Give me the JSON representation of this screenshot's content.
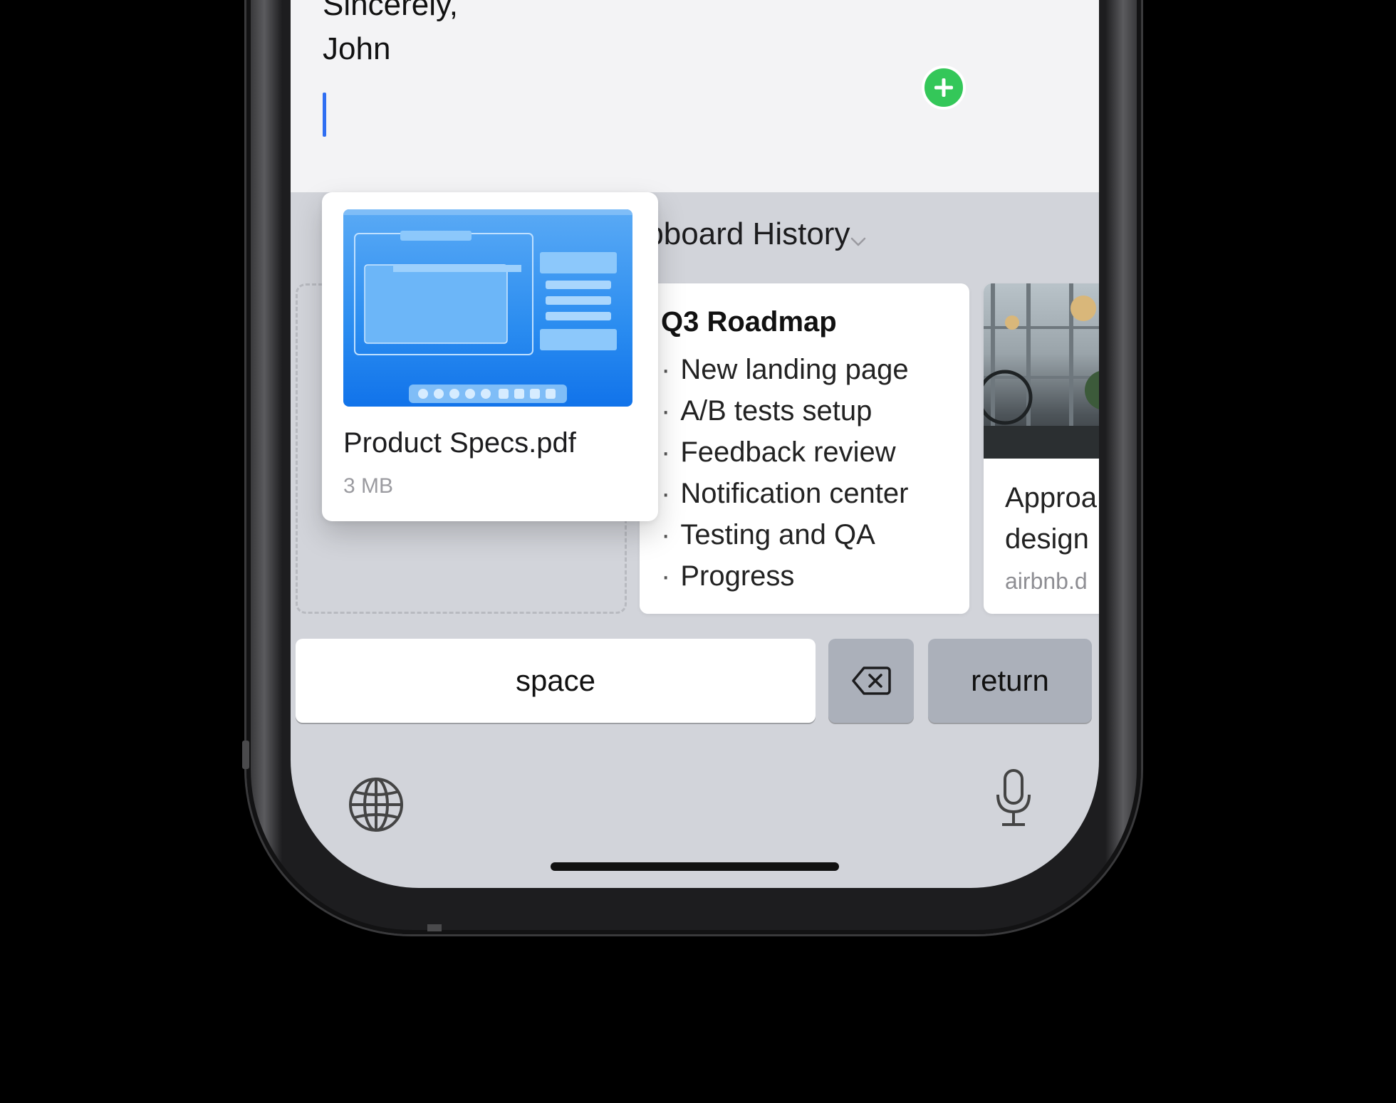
{
  "compose": {
    "signoff": "Sincerely,",
    "name": "John"
  },
  "clipboard": {
    "title": "Clipboard History",
    "dragged_item": {
      "file_name": "Product Specs.pdf",
      "file_size": "3 MB"
    },
    "roadmap_card": {
      "title": "Q3 Roadmap",
      "items": [
        "New landing page",
        "A/B tests setup",
        "Feedback review",
        "Notification center",
        "Testing and QA",
        "Progress"
      ]
    },
    "link_card": {
      "title_line1": "Approa",
      "title_line2": "design",
      "url": "airbnb.d"
    }
  },
  "keyboard": {
    "space_label": "space",
    "return_label": "return"
  },
  "icons": {
    "add": "plus-circle-icon",
    "delete": "delete-backspace-icon",
    "globe": "globe-icon",
    "mic": "microphone-icon",
    "chevron": "chevron-down-icon"
  },
  "colors": {
    "accent_caret": "#2f6ef2",
    "add_badge": "#34c759",
    "keyboard_bg": "#d2d4da",
    "pdf_thumb": "#2a8cf0"
  }
}
